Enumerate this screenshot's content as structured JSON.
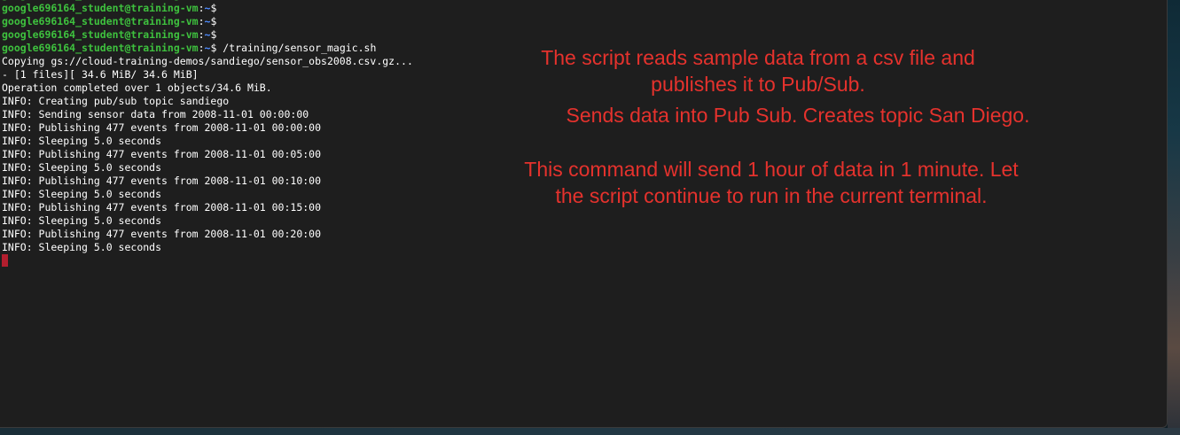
{
  "prompt": {
    "user_host": "google696164_student@training-vm",
    "sep": ":",
    "path": "~",
    "symbol": "$"
  },
  "terminal": {
    "command": " /training/sensor_magic.sh",
    "lines": [
      "Copying gs://cloud-training-demos/sandiego/sensor_obs2008.csv.gz...",
      "- [1 files][ 34.6 MiB/ 34.6 MiB]",
      "Operation completed over 1 objects/34.6 MiB.",
      "INFO: Creating pub/sub topic sandiego",
      "INFO: Sending sensor data from 2008-11-01 00:00:00",
      "INFO: Publishing 477 events from 2008-11-01 00:00:00",
      "INFO: Sleeping 5.0 seconds",
      "INFO: Publishing 477 events from 2008-11-01 00:05:00",
      "INFO: Sleeping 5.0 seconds",
      "INFO: Publishing 477 events from 2008-11-01 00:10:00",
      "INFO: Sleeping 5.0 seconds",
      "INFO: Publishing 477 events from 2008-11-01 00:15:00",
      "INFO: Sleeping 5.0 seconds",
      "INFO: Publishing 477 events from 2008-11-01 00:20:00",
      "INFO: Sleeping 5.0 seconds"
    ]
  },
  "annotations": {
    "note1": "The script reads sample data from a csv file and\npublishes it to Pub/Sub.",
    "note2": "Sends data into Pub Sub. Creates topic San Diego.",
    "note3": "This command will send 1 hour of data in 1 minute. Let\nthe script continue to run in the current terminal."
  },
  "colors": {
    "terminal_bg": "#1e1e1e",
    "prompt_user": "#3ec13e",
    "prompt_path": "#4f8cff",
    "annotation": "#e5322d",
    "cursor": "#b31e2e"
  }
}
